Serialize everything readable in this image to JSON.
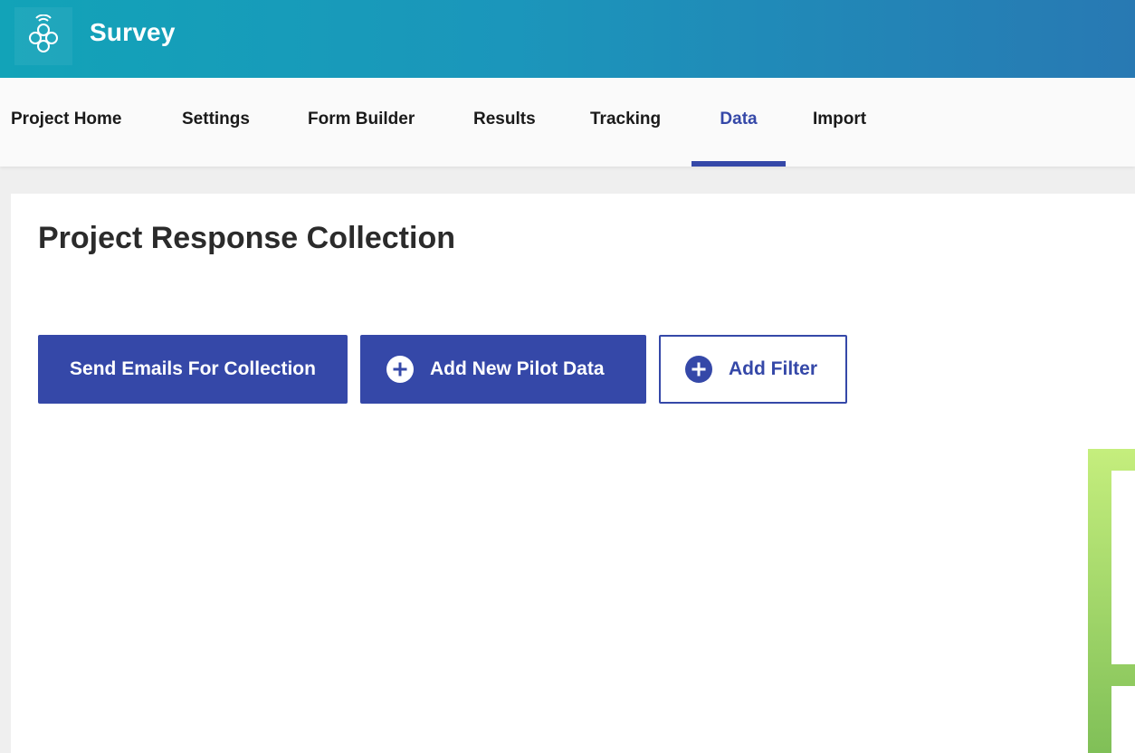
{
  "header": {
    "app_title": "Survey",
    "logo_icon": "survey-logo-icon",
    "gradient_start": "#12a3b8",
    "gradient_end": "#2879b3"
  },
  "nav": {
    "tabs": [
      {
        "label": "Project Home",
        "active": false
      },
      {
        "label": "Settings",
        "active": false
      },
      {
        "label": "Form Builder",
        "active": false
      },
      {
        "label": "Results",
        "active": false
      },
      {
        "label": "Tracking",
        "active": false
      },
      {
        "label": "Data",
        "active": true
      },
      {
        "label": "Import",
        "active": false
      }
    ],
    "active_color": "#3548a8"
  },
  "main": {
    "title": "Project Response Collection",
    "buttons": {
      "send_emails": "Send Emails For Collection",
      "add_pilot_data": "Add New Pilot Data",
      "add_filter": "Add Filter"
    },
    "icons": {
      "add": "plus-circle-icon"
    },
    "accent_color": "#3548a8",
    "decoration_color": "#9ed36a"
  }
}
